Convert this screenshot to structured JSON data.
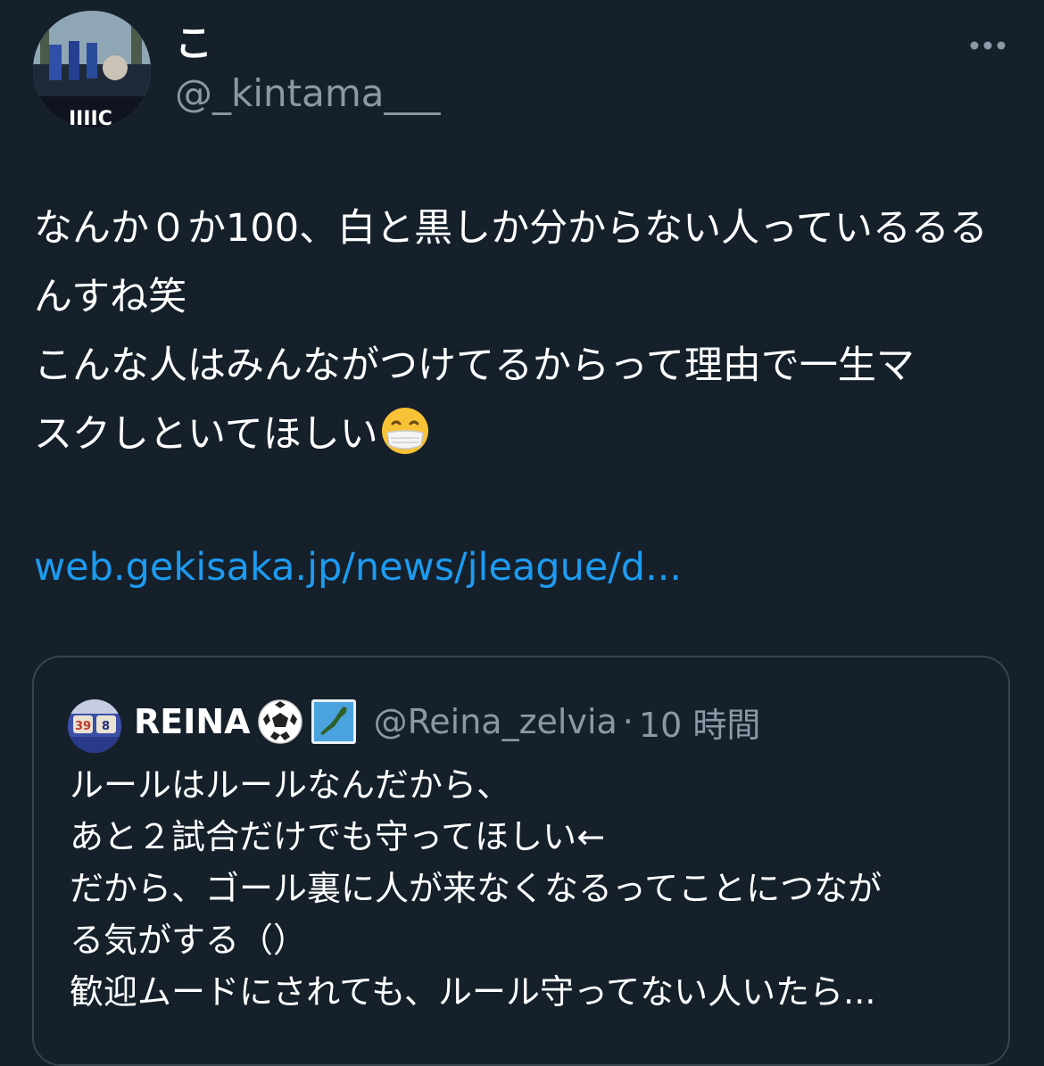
{
  "tweet": {
    "author": {
      "display_name": "こ",
      "handle": "@_kintama___"
    },
    "text_lines": [
      "なんか０か100、白と黒しか分からない人っているるる",
      "んすね笑",
      "こんな人はみんながつけてるからって理由で一生マ",
      "スクしといてほしい"
    ],
    "link": "web.gekisaka.jp/news/jleague/d..."
  },
  "quote": {
    "author": {
      "display_name": "REINA",
      "handle": "@Reina_zelvia",
      "separator": "·",
      "time": "10 時間"
    },
    "text_lines": [
      "ルールはルールなんだから、",
      "あと２試合だけでも守ってほしい←",
      "だから、ゴール裏に人が来なくなるってことにつなが",
      "る気がする（）",
      "歓迎ムードにされても、ルール守ってない人いたら..."
    ]
  },
  "icons": {
    "more": "more-horizontal-icon",
    "mask_emoji": "face-with-medical-mask-emoji",
    "soccer_emoji": "soccer-ball-emoji",
    "japan_emoji": "map-of-japan-emoji"
  },
  "colors": {
    "background": "#15202b",
    "text_primary": "#ffffff",
    "text_secondary": "#8b98a5",
    "link": "#1d9bf0",
    "border": "#38444d"
  }
}
